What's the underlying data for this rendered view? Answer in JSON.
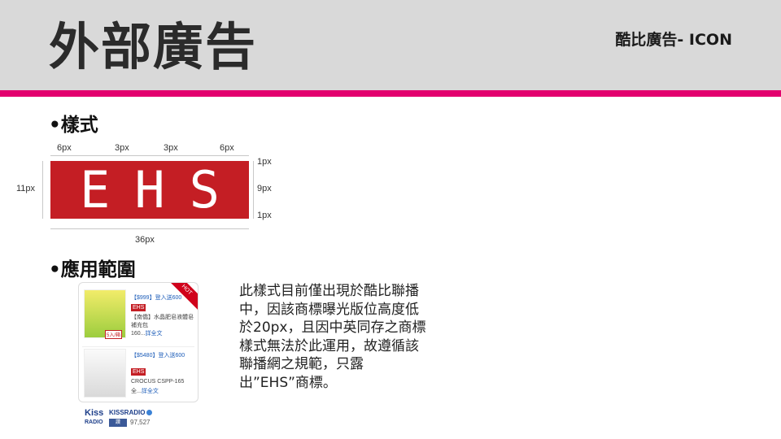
{
  "header": {
    "title": "外部廣告",
    "subtitle": "酷比廣告- ICON"
  },
  "sections": {
    "style_heading": "•樣式",
    "usage_heading": "•應用範圍"
  },
  "spec": {
    "badge_text": "EHS",
    "badge_color": "#c41e24",
    "top_dims": [
      "6px",
      "3px",
      "3px",
      "6px"
    ],
    "right_dims": [
      "1px",
      "9px",
      "1px"
    ],
    "left_dim": "11px",
    "bottom_dim": "36px"
  },
  "thumbnail": {
    "hot_label": "HOT",
    "product1": {
      "price": "【$999】登入送600",
      "ehs": "EHS",
      "name": "【南僑】水晶肥皂液體皂補充包",
      "more": "160...",
      "more_link": "詳全文",
      "pack": "5入/箱"
    },
    "product2": {
      "brand": "CROCUS CSPP-165",
      "price": "【$5480】登入送600",
      "ehs": "EHS",
      "name": "CROCUS CSPP-165",
      "more": "全...",
      "more_link": "詳全文"
    },
    "station": {
      "logo_main": "Kiss",
      "logo_sub": "RADIO",
      "name": "KISSRADIO",
      "like_label": "讚",
      "like_count": "97,527"
    }
  },
  "description": "此樣式目前僅出現於酷比聯播中，因該商標曝光版位高度低於20px，且因中英同存之商標樣式無法於此運用，故遵循該聯播網之規範，只露出”EHS”商標。",
  "colors": {
    "header_bg": "#d9d9d9",
    "accent_rule": "#e3006e"
  }
}
